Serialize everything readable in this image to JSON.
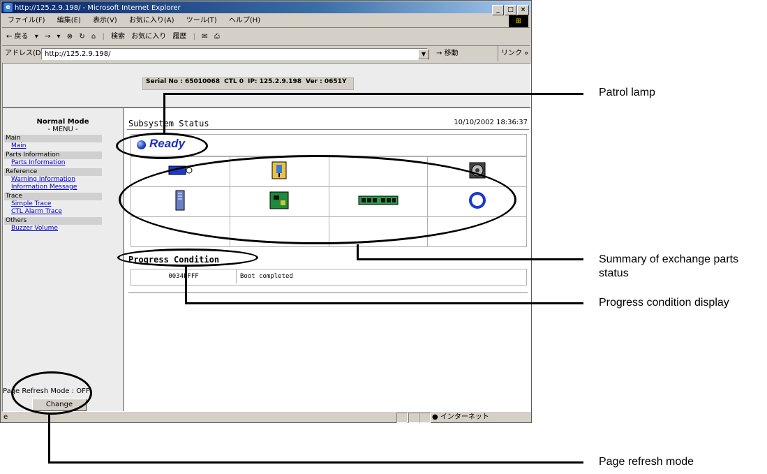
{
  "window": {
    "title": "http://125.2.9.198/ - Microsoft Internet Explorer",
    "menu": [
      "ファイル(F)",
      "編集(E)",
      "表示(V)",
      "お気に入り(A)",
      "ツール(T)",
      "ヘルプ(H)"
    ],
    "toolbar": [
      "← 戻る",
      "▾",
      "→",
      "▾",
      "⊗",
      "↻",
      "⌂",
      "検索",
      "お気に入り",
      "履歴"
    ],
    "address_label": "アドレス(D)",
    "address_value": "http://125.2.9.198/",
    "go_label": "移動",
    "links_label": "リンク »",
    "status_zone": "インターネット",
    "controls": [
      "_",
      "□",
      "×"
    ]
  },
  "info_bar": {
    "serial": "Serial No : 65010068",
    "ctl": "CTL 0",
    "ip": "IP: 125.2.9.198",
    "ver": "Ver : 0651Y"
  },
  "sidebar": {
    "mode": "Normal Mode",
    "menu_header": "- MENU -",
    "sections": [
      {
        "category": "Main",
        "links": [
          "Main"
        ]
      },
      {
        "category": "Parts Information",
        "links": [
          "Parts Information"
        ]
      },
      {
        "category": "Reference",
        "links": [
          "Warning Information",
          "Information Message"
        ]
      },
      {
        "category": "Trace",
        "links": [
          "Simple Trace",
          "CTL Alarm Trace"
        ]
      },
      {
        "category": "Others",
        "links": [
          "Buzzer Volume"
        ]
      }
    ],
    "refresh_label": "Page Refresh Mode : OFF",
    "change_button": "Change"
  },
  "main": {
    "title": "Subsystem Status",
    "timestamp": "10/10/2002 18:36:37",
    "status": "Ready",
    "progress_title": "Progress Condition",
    "progress_code": "0034FFFF",
    "progress_message": "Boot completed"
  },
  "parts_icons": [
    [
      "battery-icon",
      "power-supply-icon",
      "",
      "fan-icon"
    ],
    [
      "drive-icon",
      "controller-board-icon",
      "cache-memory-icon",
      "ring-icon"
    ],
    [
      "",
      "",
      "",
      ""
    ]
  ],
  "callouts": {
    "patrol_lamp": "Patrol lamp",
    "summary": "Summary of exchange parts status",
    "progress": "Progress condition display",
    "refresh": "Page refresh mode"
  }
}
